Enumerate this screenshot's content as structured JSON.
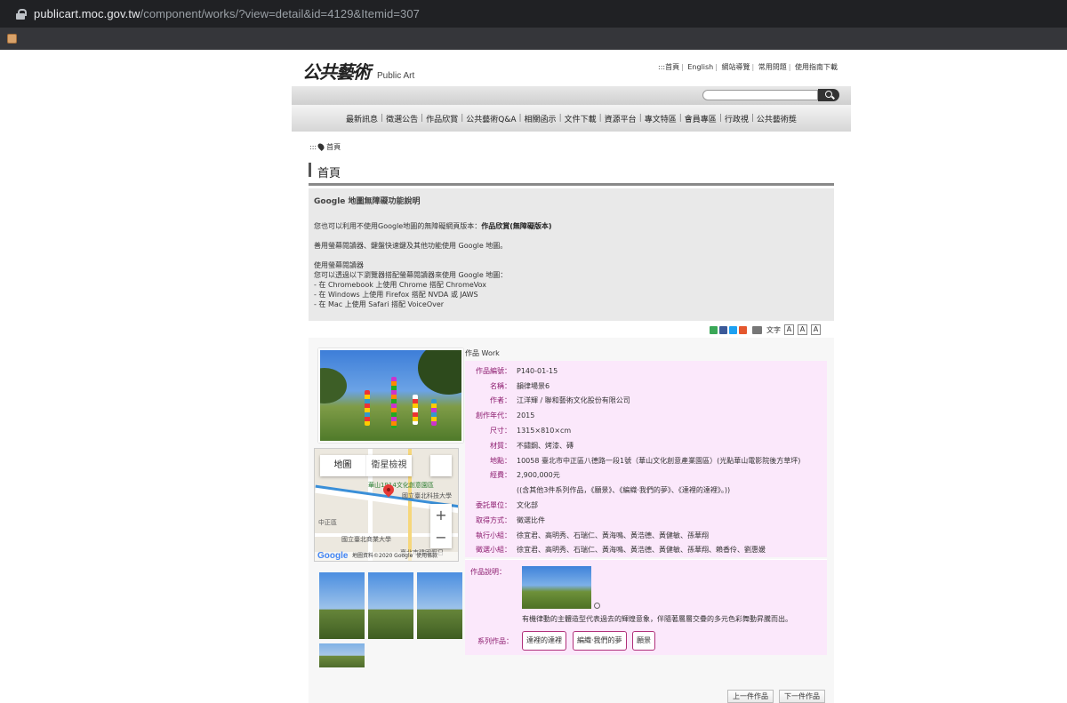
{
  "browser": {
    "url_host": "publicart.moc.gov.tw",
    "url_rest": "/component/works/?view=detail&id=4129&Itemid=307"
  },
  "header": {
    "logo_cn": "公共藝術",
    "logo_en": "Public Art",
    "top_links": [
      ":::首頁",
      "English",
      "網站導覽",
      "常用問題",
      "使用指南下載"
    ]
  },
  "nav": [
    "最新訊息",
    "徵選公告",
    "作品欣賞",
    "公共藝術Q&A",
    "相關函示",
    "文件下載",
    "資源平台",
    "專文特區",
    "會員專區",
    "行政視",
    "公共藝術獎"
  ],
  "breadcrumb": {
    "prefix": ":::",
    "item": "首頁"
  },
  "page_title": "首頁",
  "notice": {
    "heading": "Google 地圖無障礙功能說明",
    "line1_text": "您也可以利用不使用Google地圖的無障礙網頁版本：",
    "line1_bold": "作品欣賞(無障礙版本)",
    "line2": "善用螢幕閱讀器、鍵盤快速鍵及其他功能使用 Google 地圖。",
    "line3": "使用螢幕閱讀器",
    "line4": "您可以透過以下瀏覽器搭配螢幕閱讀器來使用 Google 地圖：",
    "line5": "- 在 Chromebook 上使用 Chrome 搭配 ChromeVox",
    "line6": "- 在 Windows 上使用 Firefox 搭配 NVDA 或 JAWS",
    "line7": "- 在 Mac 上使用 Safari 搭配 VoiceOver"
  },
  "tools": {
    "font_label": "文字",
    "font_sizes": [
      "A",
      "A",
      "A"
    ]
  },
  "map": {
    "tab_map": "地圖",
    "tab_satellite": "衛星檢視",
    "zoom_in": "+",
    "zoom_out": "−",
    "attribution": "地圖資料©2020 Google",
    "terms": "使用條款",
    "google": "Google",
    "labels": [
      "華山1914文化創意園區",
      "國立臺北科技大學",
      "中正區",
      "國立臺北商業大學",
      "臺北市建國假日"
    ]
  },
  "work": {
    "section_label": "作品 Work",
    "fields": [
      {
        "k": "作品編號：",
        "v": "P140-01-15"
      },
      {
        "k": "名稱：",
        "v": "韻律場景6"
      },
      {
        "k": "作者：",
        "v": "江洋輝 / 聯和藝術文化股份有限公司"
      },
      {
        "k": "創作年代：",
        "v": "2015"
      },
      {
        "k": "尺寸：",
        "v": "1315×810×cm"
      },
      {
        "k": "材質：",
        "v": "不鏽鋼、烤漆、磚"
      },
      {
        "k": "地點：",
        "v": "10058 臺北市中正區八德路一段1號（華山文化創意產業園區）(光點華山電影院後方草坪)"
      },
      {
        "k": "經費：",
        "v": "2,900,000元"
      },
      {
        "k": "",
        "v": "((含其他3件系列作品，《願景》、《編織‧我們的夢》、《達裡的達裡》。))"
      },
      {
        "k": "委託單位：",
        "v": "文化部"
      },
      {
        "k": "取得方式：",
        "v": "徵選比件"
      },
      {
        "k": "執行小組：",
        "v": "徐宜君、高明秀、石瑞仁、黃海鳴、黃浩德、黃健敏、孫華翔"
      },
      {
        "k": "徵選小組：",
        "v": "徐宜君、高明秀、石瑞仁、黃海鳴、黃浩德、黃健敏、孫華翔、賴香伶、劉惠媛"
      }
    ],
    "desc_label": "作品說明：",
    "desc_text": "有機律動的主體造型代表過去的輝煌意象，伴隨著層層交疊的多元色彩舞動昇騰而出。",
    "series_label": "系列作品：",
    "series": [
      "達裡的達裡",
      "編織‧我們的夢",
      "願景"
    ]
  },
  "pager": {
    "prev": "上一件作品",
    "next": "下一件作品"
  }
}
